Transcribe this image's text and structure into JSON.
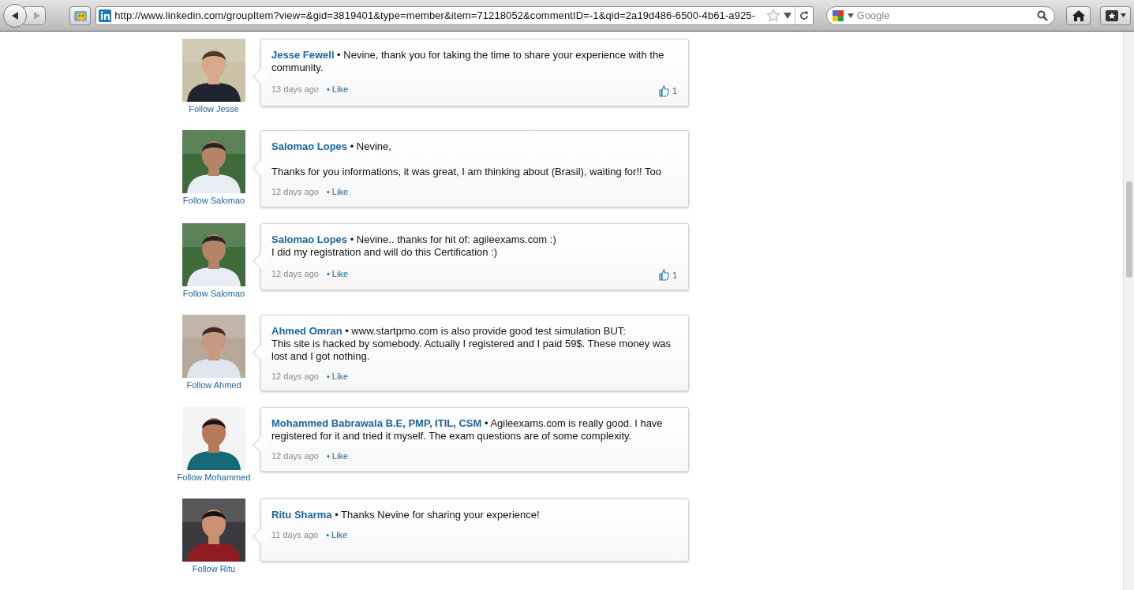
{
  "toolbar": {
    "url": "http://www.linkedin.com/groupItem?view=&gid=3819401&type=member&item=71218052&commentID=-1&qid=2a19d486-6500-4b61-a925-",
    "search_placeholder": "Google"
  },
  "comments": [
    {
      "author": "Jesse Fewell",
      "text": "• Nevine, thank you for taking the time to share your experience with the community.",
      "time": "13 days ago",
      "like": "• Like",
      "likes": "1",
      "follow": "Follow Jesse"
    },
    {
      "author": "Salomao Lopes",
      "text": "• Nevine,\n\nThanks for you informations, it was great, I am thinking about (Brasil), waiting for!! Too",
      "time": "12 days ago",
      "like": "• Like",
      "follow": "Follow Salomao"
    },
    {
      "author": "Salomao Lopes",
      "text": "• Nevine.. thanks for hit of: agileexams.com :)\nI did my registration and will do this Certification :)",
      "time": "12 days ago",
      "like": "• Like",
      "likes": "1",
      "follow": "Follow Salomao"
    },
    {
      "author": "Ahmed Omran",
      "text": "• www.startpmo.com is also provide good test simulation BUT:\nThis site is hacked by somebody. Actually I registered and I paid 59$. These money was lost and I got nothing.",
      "time": "12 days ago",
      "like": "• Like",
      "follow": "Follow Ahmed"
    },
    {
      "author": "Mohammed Babrawala B.E, PMP, ITIL, CSM",
      "text": "• Agileexams.com is really good. I have registered for it and tried it myself. The exam questions are of some complexity.",
      "time": "12 days ago",
      "like": "• Like",
      "follow": "Follow Mohammed"
    },
    {
      "author": "Ritu Sharma",
      "text": "• Thanks Nevine for sharing your experience!",
      "time": "11 days ago",
      "like": "• Like",
      "follow": "Follow Ritu"
    }
  ]
}
